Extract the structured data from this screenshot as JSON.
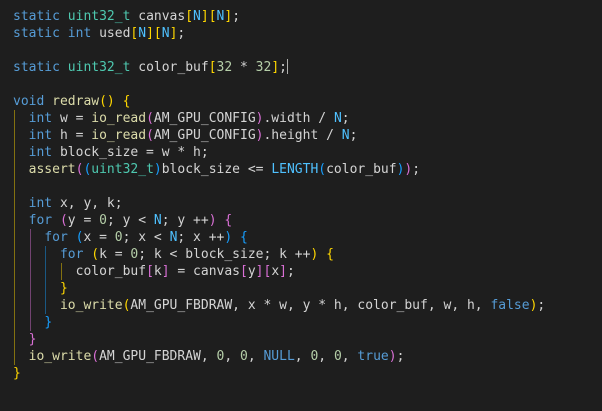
{
  "editor": {
    "colors": {
      "background": "#1e1e1e",
      "default": "#d4d4d4",
      "keyword": "#569cd6",
      "type": "#4ec9b0",
      "function": "#dcdcaa",
      "macro": "#4fc1ff",
      "number": "#b5cea8",
      "bracket_gold": "#ffd700",
      "bracket_purple": "#da70d6",
      "bracket_blue": "#179fff",
      "guide": "#404040",
      "cursor": "#aeafad"
    },
    "lines": [
      {
        "tokens": [
          [
            "static ",
            "keyword"
          ],
          [
            "uint32_t ",
            "type"
          ],
          [
            "canvas",
            "default"
          ],
          [
            "[",
            "bracket_gold"
          ],
          [
            "N",
            "macro"
          ],
          [
            "][",
            "bracket_gold"
          ],
          [
            "N",
            "macro"
          ],
          [
            "]",
            "bracket_gold"
          ],
          [
            ";",
            "default"
          ]
        ]
      },
      {
        "tokens": [
          [
            "static ",
            "keyword"
          ],
          [
            "int ",
            "keyword"
          ],
          [
            "used",
            "default"
          ],
          [
            "[",
            "bracket_gold"
          ],
          [
            "N",
            "macro"
          ],
          [
            "][",
            "bracket_gold"
          ],
          [
            "N",
            "macro"
          ],
          [
            "]",
            "bracket_gold"
          ],
          [
            ";",
            "default"
          ]
        ]
      },
      {
        "tokens": []
      },
      {
        "tokens": [
          [
            "static ",
            "keyword"
          ],
          [
            "uint32_t ",
            "type"
          ],
          [
            "color_buf",
            "default"
          ],
          [
            "[",
            "bracket_gold"
          ],
          [
            "32",
            "number"
          ],
          [
            " * ",
            "default"
          ],
          [
            "32",
            "number"
          ],
          [
            "]",
            "bracket_gold"
          ],
          [
            ";",
            "default"
          ]
        ],
        "cursor": true
      },
      {
        "tokens": []
      },
      {
        "tokens": [
          [
            "void ",
            "keyword"
          ],
          [
            "redraw",
            "function"
          ],
          [
            "()",
            "bracket_gold"
          ],
          [
            " ",
            "default"
          ],
          [
            "{",
            "bracket_gold"
          ]
        ]
      },
      {
        "tokens": [
          [
            "  ",
            "default"
          ],
          [
            "int ",
            "keyword"
          ],
          [
            "w = ",
            "default"
          ],
          [
            "io_read",
            "function"
          ],
          [
            "(",
            "bracket_purple"
          ],
          [
            "AM_GPU_CONFIG",
            "default"
          ],
          [
            ")",
            "bracket_purple"
          ],
          [
            ".width / ",
            "default"
          ],
          [
            "N",
            "macro"
          ],
          [
            ";",
            "default"
          ]
        ]
      },
      {
        "tokens": [
          [
            "  ",
            "default"
          ],
          [
            "int ",
            "keyword"
          ],
          [
            "h = ",
            "default"
          ],
          [
            "io_read",
            "function"
          ],
          [
            "(",
            "bracket_purple"
          ],
          [
            "AM_GPU_CONFIG",
            "default"
          ],
          [
            ")",
            "bracket_purple"
          ],
          [
            ".height / ",
            "default"
          ],
          [
            "N",
            "macro"
          ],
          [
            ";",
            "default"
          ]
        ]
      },
      {
        "tokens": [
          [
            "  ",
            "default"
          ],
          [
            "int ",
            "keyword"
          ],
          [
            "block_size = w * h;",
            "default"
          ]
        ]
      },
      {
        "tokens": [
          [
            "  ",
            "default"
          ],
          [
            "assert",
            "function"
          ],
          [
            "(",
            "bracket_purple"
          ],
          [
            "(",
            "bracket_blue"
          ],
          [
            "uint32_t",
            "type"
          ],
          [
            ")",
            "bracket_blue"
          ],
          [
            "block_size <= ",
            "default"
          ],
          [
            "LENGTH",
            "macro"
          ],
          [
            "(",
            "bracket_blue"
          ],
          [
            "color_buf",
            "default"
          ],
          [
            ")",
            "bracket_blue"
          ],
          [
            ")",
            "bracket_purple"
          ],
          [
            ";",
            "default"
          ]
        ]
      },
      {
        "tokens": []
      },
      {
        "tokens": [
          [
            "  ",
            "default"
          ],
          [
            "int ",
            "keyword"
          ],
          [
            "x, y, k;",
            "default"
          ]
        ]
      },
      {
        "tokens": [
          [
            "  ",
            "default"
          ],
          [
            "for ",
            "keyword"
          ],
          [
            "(",
            "bracket_purple"
          ],
          [
            "y = ",
            "default"
          ],
          [
            "0",
            "number"
          ],
          [
            "; y < ",
            "default"
          ],
          [
            "N",
            "macro"
          ],
          [
            "; y ++",
            "default"
          ],
          [
            ")",
            "bracket_purple"
          ],
          [
            " ",
            "default"
          ],
          [
            "{",
            "bracket_purple"
          ]
        ]
      },
      {
        "tokens": [
          [
            "    ",
            "default"
          ],
          [
            "for ",
            "keyword"
          ],
          [
            "(",
            "bracket_blue"
          ],
          [
            "x = ",
            "default"
          ],
          [
            "0",
            "number"
          ],
          [
            "; x < ",
            "default"
          ],
          [
            "N",
            "macro"
          ],
          [
            "; x ++",
            "default"
          ],
          [
            ")",
            "bracket_blue"
          ],
          [
            " ",
            "default"
          ],
          [
            "{",
            "bracket_blue"
          ]
        ]
      },
      {
        "tokens": [
          [
            "      ",
            "default"
          ],
          [
            "for ",
            "keyword"
          ],
          [
            "(",
            "bracket_gold"
          ],
          [
            "k = ",
            "default"
          ],
          [
            "0",
            "number"
          ],
          [
            "; k < block_size; k ++",
            "default"
          ],
          [
            ")",
            "bracket_gold"
          ],
          [
            " ",
            "default"
          ],
          [
            "{",
            "bracket_gold"
          ]
        ]
      },
      {
        "tokens": [
          [
            "        ",
            "default"
          ],
          [
            "color_buf",
            "default"
          ],
          [
            "[",
            "bracket_purple"
          ],
          [
            "k",
            "default"
          ],
          [
            "]",
            "bracket_purple"
          ],
          [
            " = canvas",
            "default"
          ],
          [
            "[",
            "bracket_purple"
          ],
          [
            "y",
            "default"
          ],
          [
            "]",
            "bracket_purple"
          ],
          [
            "[",
            "bracket_purple"
          ],
          [
            "x",
            "default"
          ],
          [
            "]",
            "bracket_purple"
          ],
          [
            ";",
            "default"
          ]
        ]
      },
      {
        "tokens": [
          [
            "      ",
            "default"
          ],
          [
            "}",
            "bracket_gold"
          ]
        ]
      },
      {
        "tokens": [
          [
            "      ",
            "default"
          ],
          [
            "io_write",
            "function"
          ],
          [
            "(",
            "bracket_gold"
          ],
          [
            "AM_GPU_FBDRAW",
            "default"
          ],
          [
            ", x * w, y * h, color_buf, w, h, ",
            "default"
          ],
          [
            "false",
            "keyword"
          ],
          [
            ")",
            "bracket_gold"
          ],
          [
            ";",
            "default"
          ]
        ]
      },
      {
        "tokens": [
          [
            "    ",
            "default"
          ],
          [
            "}",
            "bracket_blue"
          ]
        ]
      },
      {
        "tokens": [
          [
            "  ",
            "default"
          ],
          [
            "}",
            "bracket_purple"
          ]
        ]
      },
      {
        "tokens": [
          [
            "  ",
            "default"
          ],
          [
            "io_write",
            "function"
          ],
          [
            "(",
            "bracket_purple"
          ],
          [
            "AM_GPU_FBDRAW",
            "default"
          ],
          [
            ", ",
            "default"
          ],
          [
            "0",
            "number"
          ],
          [
            ", ",
            "default"
          ],
          [
            "0",
            "number"
          ],
          [
            ", ",
            "default"
          ],
          [
            "NULL",
            "keyword"
          ],
          [
            ", ",
            "default"
          ],
          [
            "0",
            "number"
          ],
          [
            ", ",
            "default"
          ],
          [
            "0",
            "number"
          ],
          [
            ", ",
            "default"
          ],
          [
            "true",
            "keyword"
          ],
          [
            ")",
            "bracket_purple"
          ],
          [
            ";",
            "default"
          ]
        ]
      },
      {
        "tokens": [
          [
            "}",
            "bracket_gold"
          ]
        ]
      }
    ]
  }
}
